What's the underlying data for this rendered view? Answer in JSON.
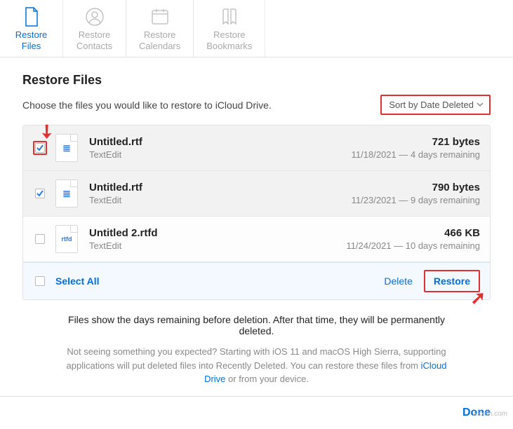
{
  "tabs": {
    "restore_files": "Restore\nFiles",
    "restore_contacts": "Restore\nContacts",
    "restore_calendars": "Restore\nCalendars",
    "restore_bookmarks": "Restore\nBookmarks"
  },
  "page_title": "Restore Files",
  "subtitle": "Choose the files you would like to restore to iCloud Drive.",
  "sort_label": "Sort by Date Deleted",
  "files": [
    {
      "name": "Untitled.rtf",
      "app": "TextEdit",
      "size": "721 bytes",
      "meta": "11/18/2021 — 4 days remaining",
      "checked": true,
      "ext": "≣"
    },
    {
      "name": "Untitled.rtf",
      "app": "TextEdit",
      "size": "790 bytes",
      "meta": "11/23/2021 — 9 days remaining",
      "checked": true,
      "ext": "≣"
    },
    {
      "name": "Untitled 2.rtfd",
      "app": "TextEdit",
      "size": "466 KB",
      "meta": "11/24/2021 — 10 days remaining",
      "checked": false,
      "ext": "rtfd"
    }
  ],
  "actions": {
    "select_all": "Select All",
    "delete": "Delete",
    "restore": "Restore"
  },
  "footer": "Files show the days remaining before deletion. After that time, they will be permanently deleted.",
  "help1": "Not seeing something you expected? Starting with iOS 11 and macOS High Sierra, supporting applications will put deleted files into Recently Deleted. You can restore these files from ",
  "help_link": "iCloud Drive",
  "help2": " or from your device.",
  "done": "Done",
  "watermark": "wsxdn.com"
}
